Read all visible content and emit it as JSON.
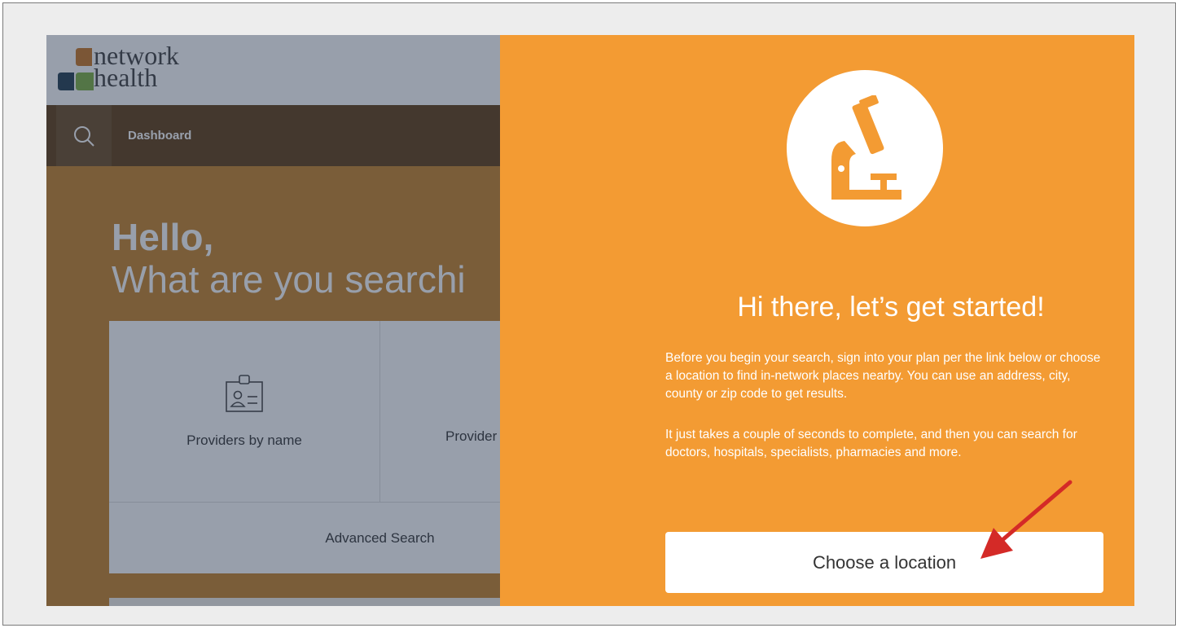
{
  "logo": {
    "line1": "network",
    "line2": "health"
  },
  "nav": {
    "search_icon": "search-icon",
    "dashboard_label": "Dashboard"
  },
  "hero": {
    "greeting": "Hello,",
    "question": "What are you searchi"
  },
  "cards": [
    {
      "label": "Providers by name",
      "icon": "id-badge-icon"
    },
    {
      "label": "Provider",
      "icon": "basket-icon"
    }
  ],
  "advanced_search_label": "Advanced Search",
  "panel": {
    "icon": "microscope-icon",
    "title": "Hi there, let’s get started!",
    "paragraph1": "Before you begin your search, sign into your plan per the link below or choose a location to find in-network places nearby. You can use an address, city, county or zip code to get results.",
    "paragraph2": "It just takes a couple of seconds to complete, and then you can search for doctors, hospitals, specialists, pharmacies and more.",
    "button_label": "Choose a location"
  },
  "colors": {
    "panel_orange": "#f39b33",
    "hero_orange": "#c58126",
    "nav_brown": "#5e3b10",
    "annotation_red": "#d42a27"
  }
}
